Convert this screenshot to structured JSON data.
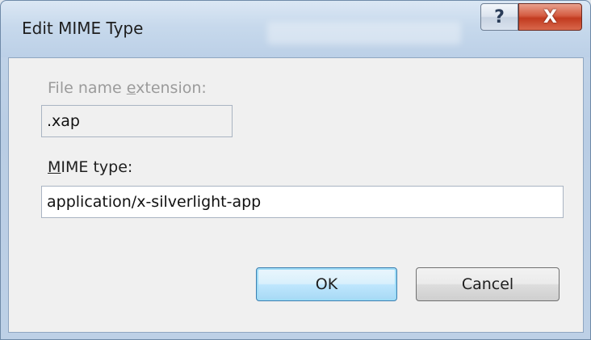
{
  "window": {
    "title": "Edit MIME Type",
    "help_glyph": "?",
    "close_glyph": "X"
  },
  "form": {
    "extension_label_pre": "File name ",
    "extension_label_accel": "e",
    "extension_label_post": "xtension:",
    "extension_value": ".xap",
    "mime_label_accel": "M",
    "mime_label_post": "IME type:",
    "mime_value": "application/x-silverlight-app"
  },
  "buttons": {
    "ok_label": "OK",
    "cancel_label": "Cancel"
  },
  "icons": [
    "help-icon",
    "close-icon"
  ],
  "colors": {
    "close_button": "#c23a1f",
    "ok_button_border": "#3c7fb1",
    "disabled_text": "#9b9b9b"
  }
}
